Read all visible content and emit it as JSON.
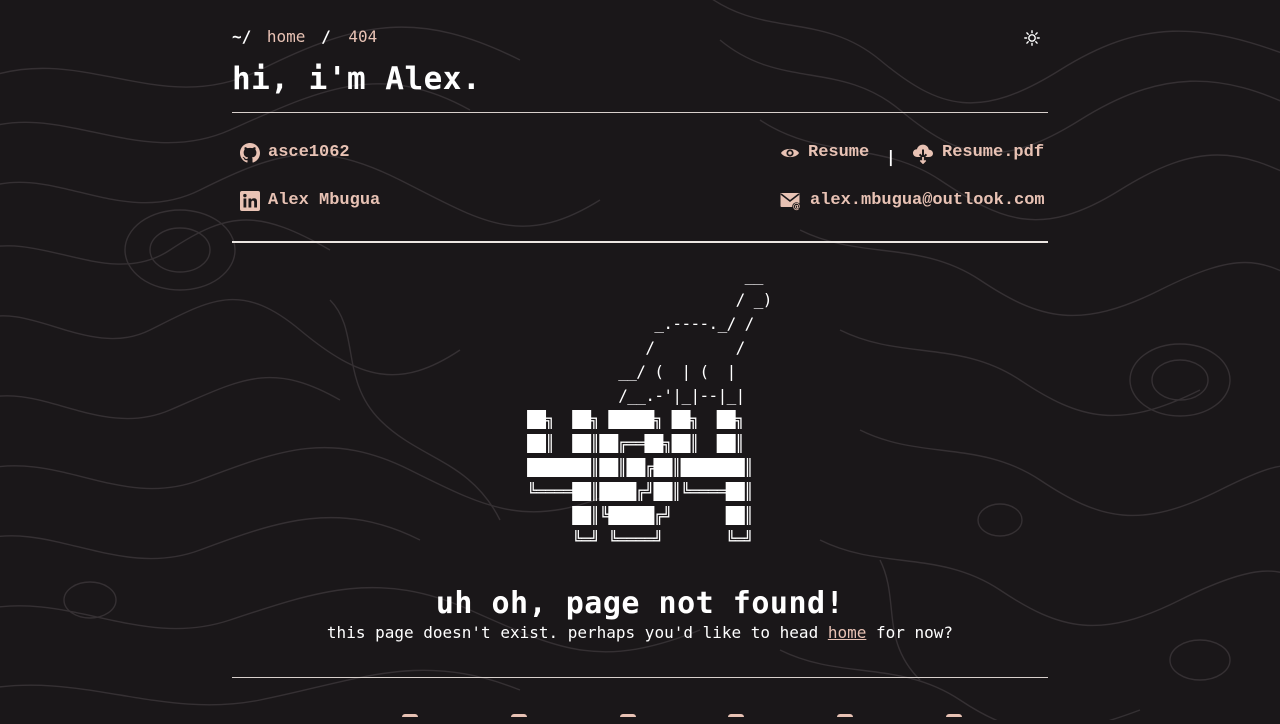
{
  "breadcrumb": {
    "root": "~/",
    "home": "home",
    "sep": "/",
    "current": "404"
  },
  "theme_toggle": {
    "icon": "sun-icon"
  },
  "header": {
    "title": "hi, i'm Alex."
  },
  "contacts": {
    "github": {
      "label": "asce1062",
      "icon": "github-icon"
    },
    "linkedin": {
      "label": "Alex Mbugua",
      "icon": "linkedin-icon"
    },
    "resume": {
      "label": "Resume",
      "icon": "eye-icon"
    },
    "pipe": "|",
    "resume_pdf": {
      "label": "Resume.pdf",
      "icon": "cloud-download-icon"
    },
    "email": {
      "label": "alex.mbugua@outlook.com",
      "icon": "mail-icon"
    }
  },
  "ascii_art": "              __\n             / _)\n    _.----._/ /\n   /         /\n__/ (  | (  |\n/__.-'|_|--|_|",
  "ascii_404": "██╗  ██╗ █████╗ ██╗  ██╗\n██║  ██║██╔══██╗██║  ██║\n███████║██║██╔██║███████║\n╚════██║████╔╝██║╚════██║\n     ██║╚█████╔╝      ██║\n     ╚═╝ ╚════╝       ╚═╝",
  "error": {
    "headline": "uh oh, page not found!",
    "sub_before": "this page doesn't exist. perhaps you'd like to head ",
    "sub_link": "home",
    "sub_after": " for now?"
  },
  "colors": {
    "background": "#1a1719",
    "accent": "#e8c2b4",
    "text": "#ffffff"
  }
}
